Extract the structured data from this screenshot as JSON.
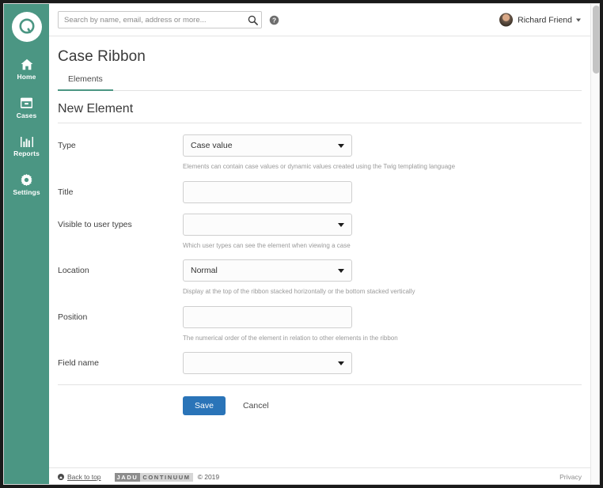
{
  "sidebar": {
    "logo_letter": "Q",
    "items": [
      {
        "label": "Home",
        "icon": "home-icon"
      },
      {
        "label": "Cases",
        "icon": "briefcase-icon"
      },
      {
        "label": "Reports",
        "icon": "bar-chart-icon"
      },
      {
        "label": "Settings",
        "icon": "gear-icon"
      }
    ]
  },
  "topbar": {
    "search_placeholder": "Search by name, email, address or more...",
    "search_value": "",
    "search_icon": "search-icon",
    "help_icon": "help-circle-icon",
    "user_name": "Richard Friend",
    "caret_icon": "chevron-down-icon"
  },
  "page": {
    "title": "Case Ribbon",
    "tabs": [
      {
        "label": "Elements",
        "active": true
      }
    ],
    "section_title": "New Element"
  },
  "form": {
    "fields": [
      {
        "label": "Type",
        "control": "select",
        "value": "Case value",
        "help": "Elements can contain case values or dynamic values created using the Twig templating language"
      },
      {
        "label": "Title",
        "control": "input",
        "value": "",
        "help": ""
      },
      {
        "label": "Visible to user types",
        "control": "select",
        "value": "",
        "help": "Which user types can see the element when viewing a case"
      },
      {
        "label": "Location",
        "control": "select",
        "value": "Normal",
        "help": "Display at the top of the ribbon stacked horizontally or the bottom stacked vertically"
      },
      {
        "label": "Position",
        "control": "input",
        "value": "",
        "help": "The numerical order of the element in relation to other elements in the ribbon"
      },
      {
        "label": "Field name",
        "control": "select",
        "value": "",
        "help": ""
      }
    ],
    "save_label": "Save",
    "cancel_label": "Cancel"
  },
  "footer": {
    "back_to_top": "Back to top",
    "logo_primary": "JADU",
    "logo_secondary": "CONTINUUM",
    "copyright": "© 2019",
    "privacy": "Privacy"
  },
  "colors": {
    "sidebar": "#4b9683",
    "accent": "#4b9683",
    "primary_button": "#2a74b8"
  }
}
